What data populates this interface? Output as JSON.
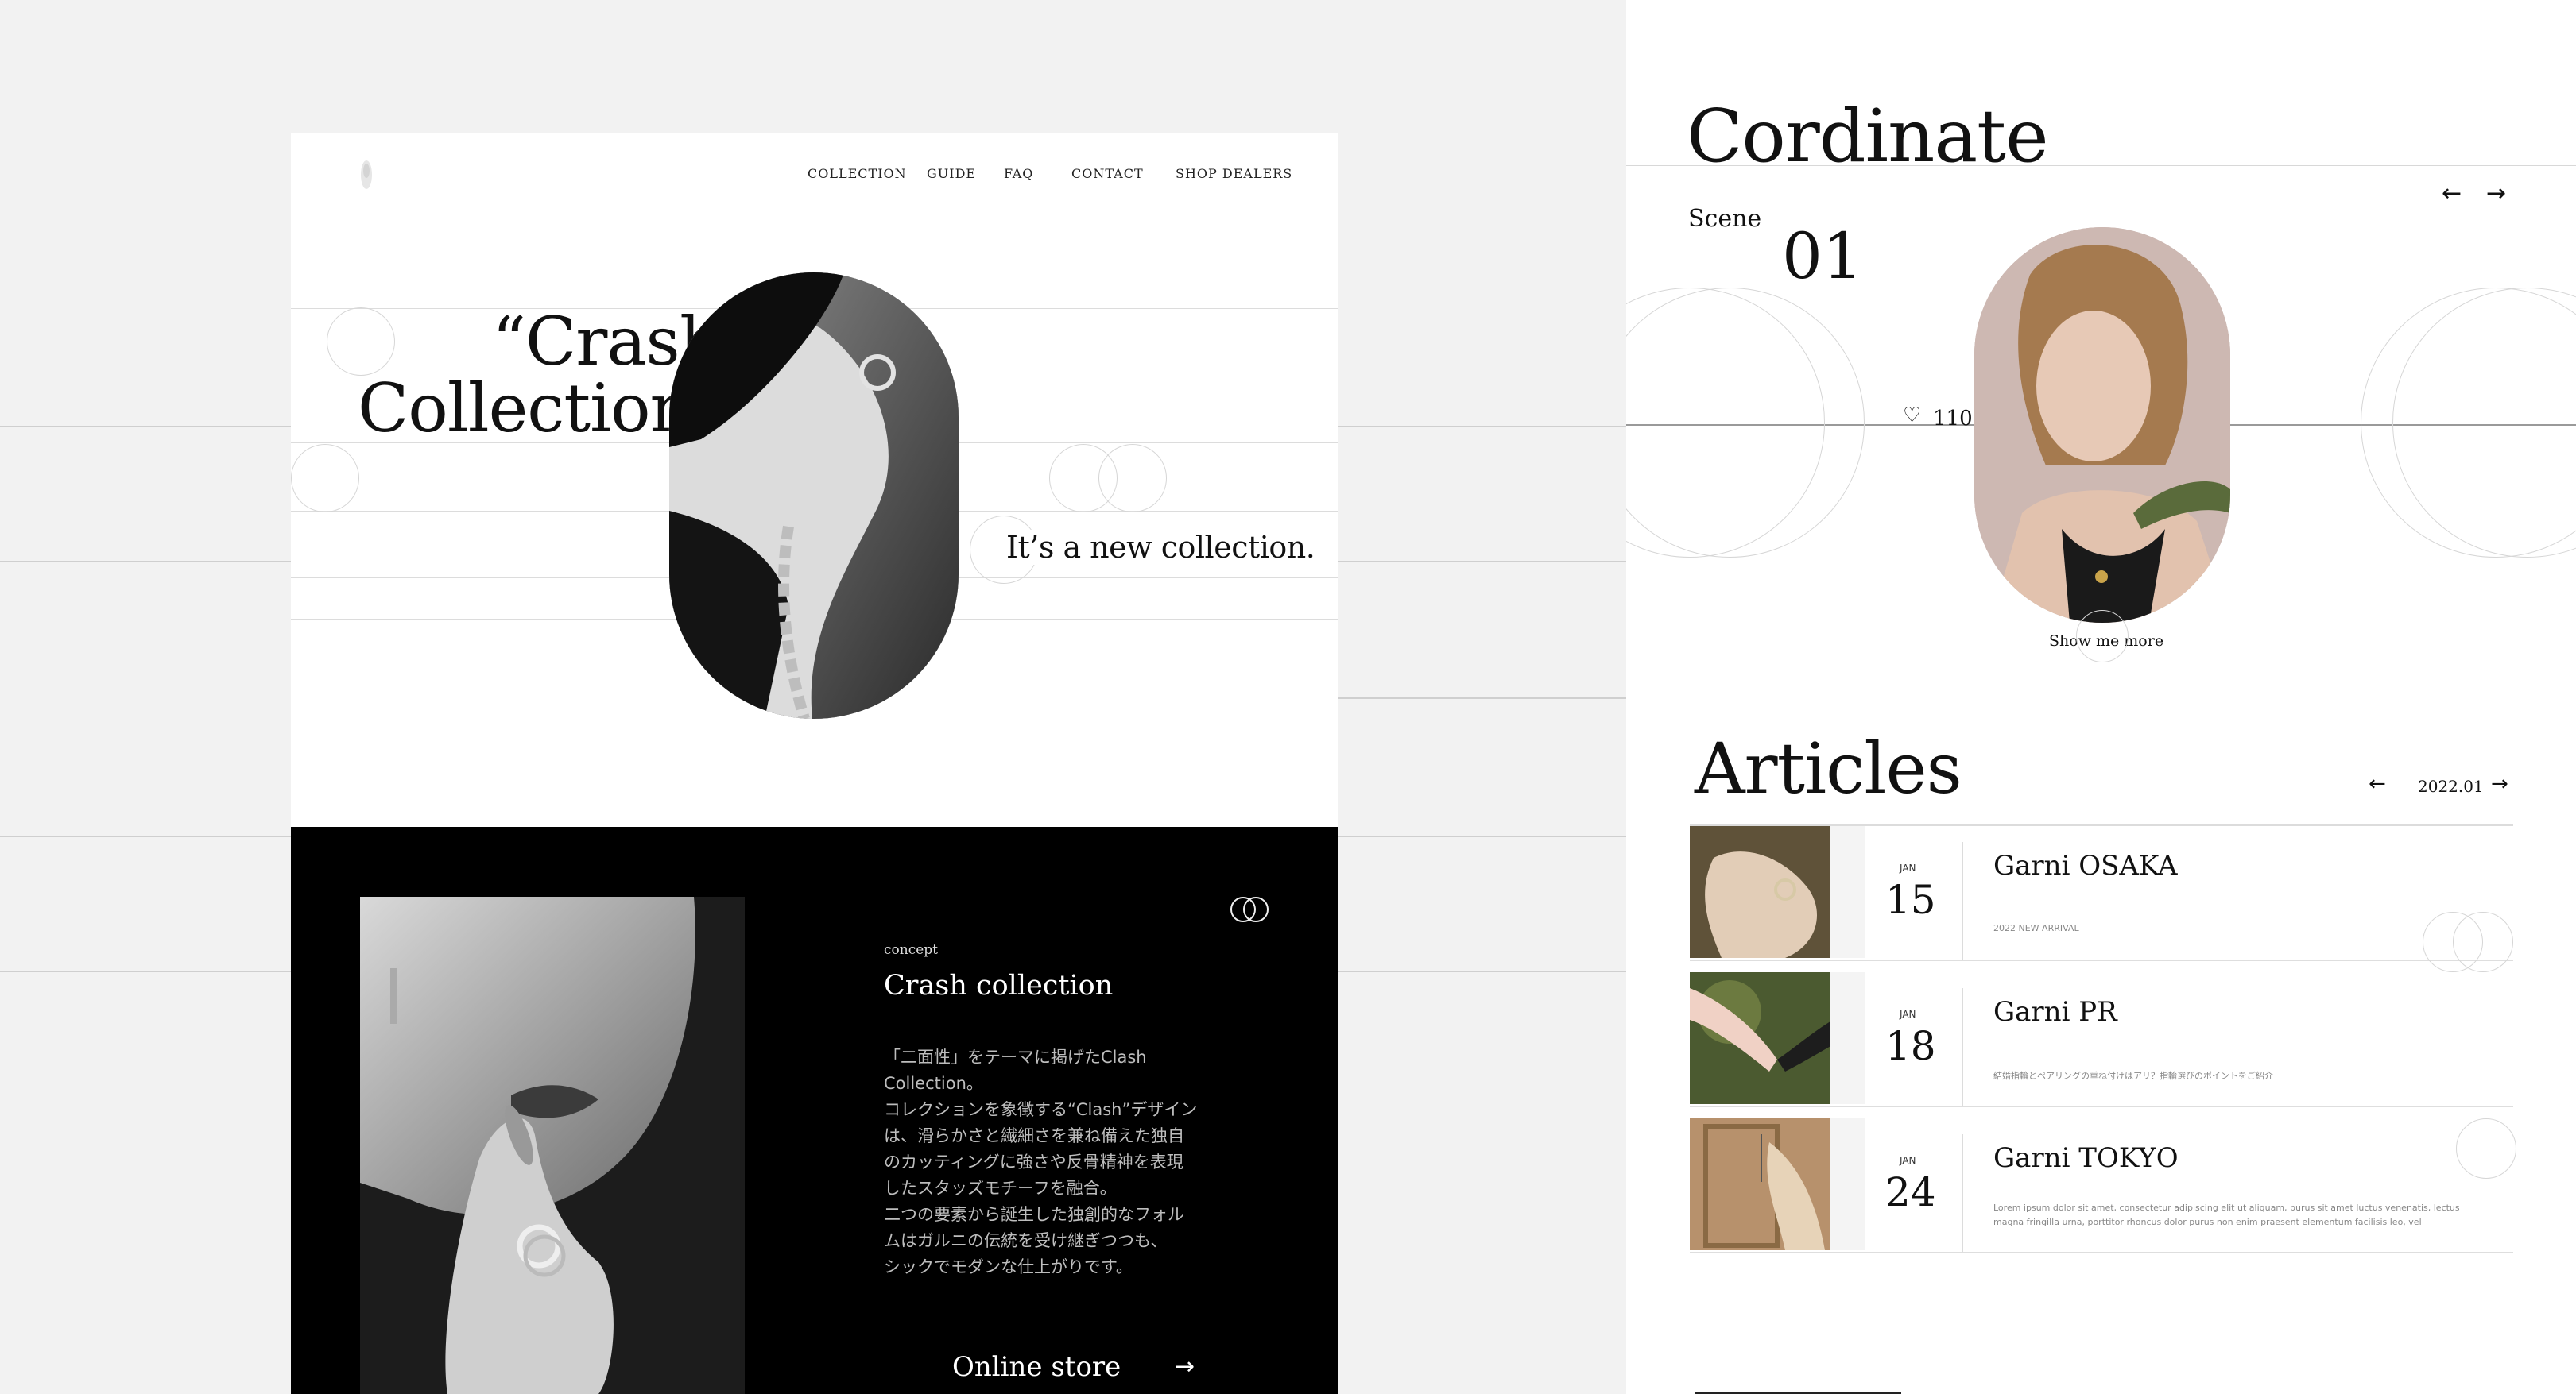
{
  "colors": {
    "background": "#f2f2f2",
    "panel": "#ffffff",
    "dark": "#000000",
    "text": "#111111"
  },
  "left": {
    "logo": "logo-mark",
    "nav": [
      "COLLECTION",
      "GUIDE",
      "FAQ",
      "CONTACT",
      "SHOP DEALERS"
    ],
    "hero": {
      "title_line1": "“Crash",
      "title_line2": "Collection”",
      "tagline": "It’s a new collection."
    },
    "concept": {
      "label": "concept",
      "heading": "Crash collection",
      "body": [
        "「二面性」をテーマに掲げたClash",
        "Collection。",
        "コレクションを象徴する“Clash”デザイン",
        "は、滑らかさと繊細さを兼ね備えた独自",
        "のカッティングに強さや反骨精神を表現",
        "したスタッズモチーフを融合。",
        "二つの要素から誕生した独創的なフォル",
        "ムはガルニの伝統を受け継ぎつつも、",
        "シックでモダンな仕上がりです。"
      ],
      "online_store": "Online store",
      "arrow": "→"
    }
  },
  "right": {
    "cordinate": {
      "title": "Cordinate",
      "scene_label": "Scene",
      "scene_number": "01",
      "likes": "110",
      "show_more": "Show me more",
      "prev": "←",
      "next": "→"
    },
    "articles": {
      "title": "Articles",
      "month": "2022.01",
      "prev": "←",
      "next": "→",
      "items": [
        {
          "month": "JAN",
          "day": "15",
          "title": "Garni OSAKA",
          "excerpt": "2022 NEW ARRIVAL"
        },
        {
          "month": "JAN",
          "day": "18",
          "title": "Garni PR",
          "excerpt": "結婚指輪とペアリングの重ね付けはアリ？指輪選びのポイントをご紹介"
        },
        {
          "month": "JAN",
          "day": "24",
          "title": "Garni TOKYO",
          "excerpt": "Lorem ipsum dolor sit amet, consectetur adipiscing elit ut aliquam, purus sit amet luctus venenatis, lectus magna fringilla urna, porttitor rhoncus dolor purus non enim praesent elementum facilisis leo, vel"
        }
      ]
    }
  }
}
